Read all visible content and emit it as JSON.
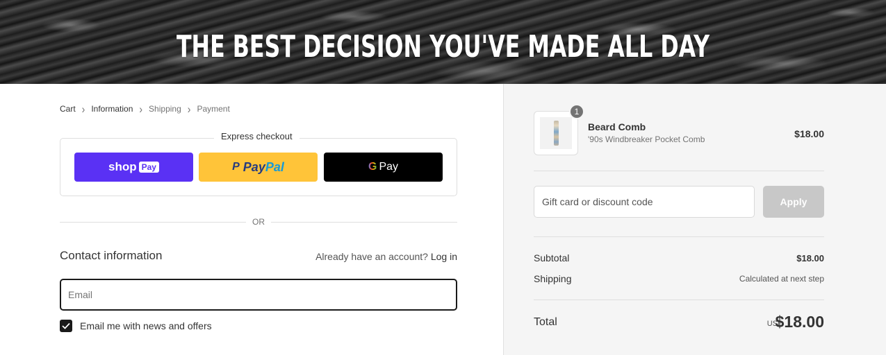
{
  "hero": {
    "title": "THE BEST DECISION YOU'VE MADE ALL DAY"
  },
  "breadcrumb": {
    "items": [
      {
        "label": "Cart"
      },
      {
        "label": "Information"
      },
      {
        "label": "Shipping"
      },
      {
        "label": "Payment"
      }
    ]
  },
  "express": {
    "label": "Express checkout",
    "shop_pay": {
      "text": "shop",
      "pill": "Pay"
    },
    "paypal": {
      "text1": "Pay",
      "text2": "Pal",
      "mark": "P"
    },
    "gpay": {
      "g": "G",
      "text": "Pay"
    }
  },
  "divider_text": "OR",
  "contact": {
    "title": "Contact information",
    "account_prompt": "Already have an account?",
    "login_label": "Log in",
    "email_placeholder": "Email",
    "newsletter_label": "Email me with news and offers",
    "newsletter_checked": true
  },
  "order": {
    "product": {
      "name": "Beard Comb",
      "variant": "'90s Windbreaker Pocket Comb",
      "price": "$18.00",
      "quantity": "1"
    },
    "discount": {
      "placeholder": "Gift card or discount code",
      "apply_label": "Apply"
    },
    "subtotal": {
      "label": "Subtotal",
      "value": "$18.00"
    },
    "shipping": {
      "label": "Shipping",
      "value": "Calculated at next step"
    },
    "total": {
      "label": "Total",
      "currency": "USD",
      "value": "$18.00"
    }
  },
  "colors": {
    "shop_pay": "#5a31f4",
    "paypal": "#ffc439",
    "gpay": "#000000",
    "summary_bg": "#f5f5f5",
    "apply_disabled": "#c8c8c8"
  }
}
